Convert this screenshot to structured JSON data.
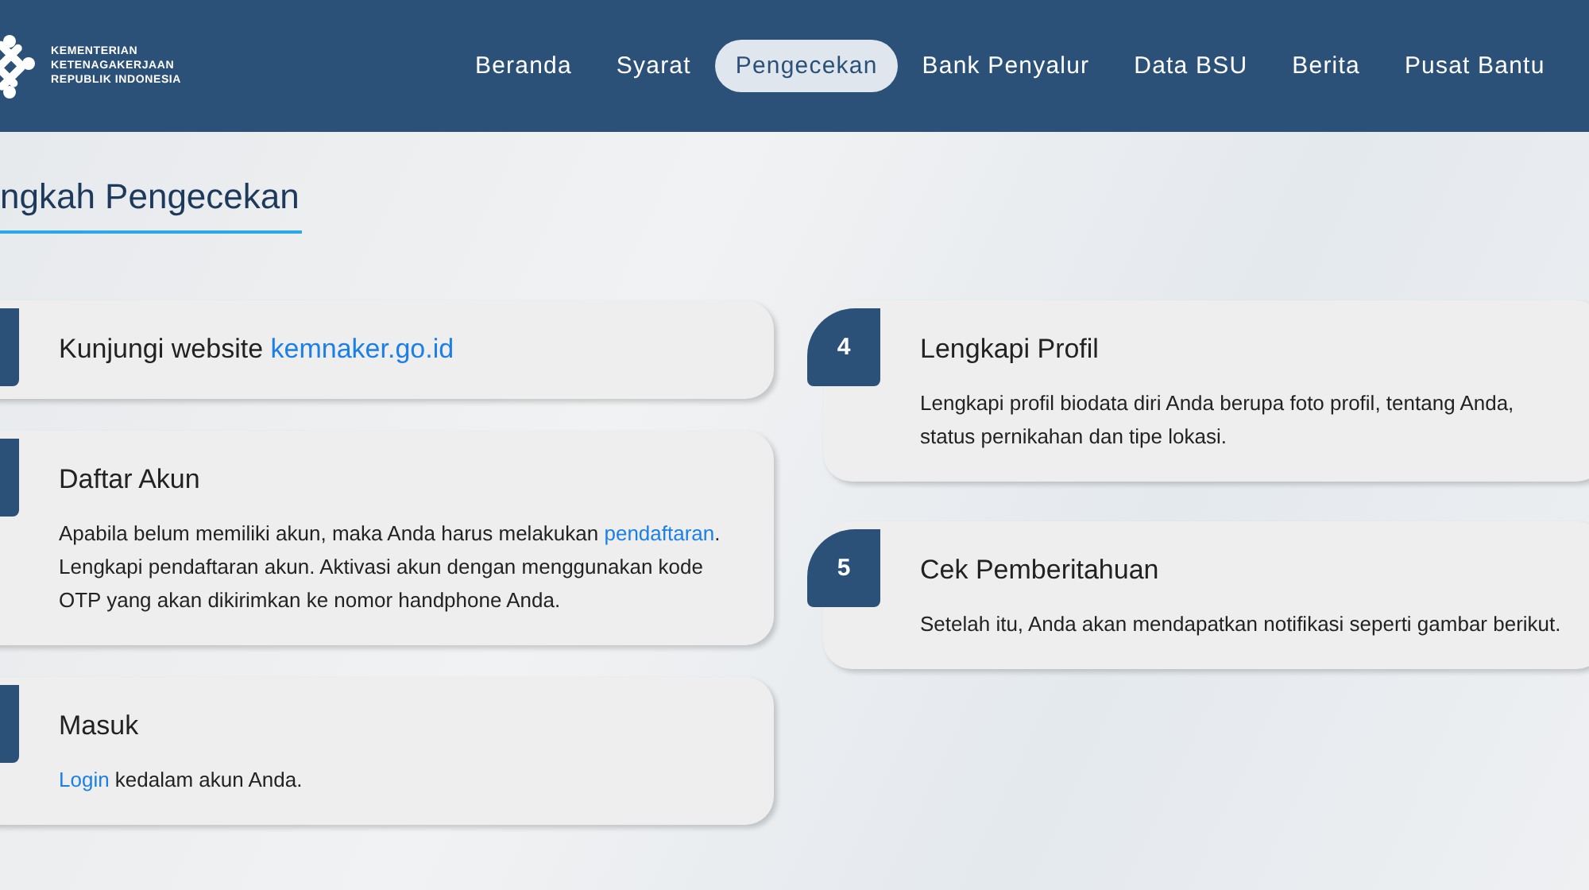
{
  "header": {
    "logo_lines": [
      "KEMENTERIAN",
      "KETENAGAKERJAAN",
      "REPUBLIK INDONESIA"
    ],
    "nav": [
      {
        "label": "Beranda",
        "selected": false
      },
      {
        "label": "Syarat",
        "selected": false
      },
      {
        "label": "Pengecekan",
        "selected": true
      },
      {
        "label": "Bank Penyalur",
        "selected": false
      },
      {
        "label": "Data BSU",
        "selected": false
      },
      {
        "label": "Berita",
        "selected": false
      },
      {
        "label": "Pusat Bantu",
        "selected": false
      }
    ]
  },
  "section_title": "ngkah Pengecekan",
  "left_steps": [
    {
      "title": [
        {
          "kind": "text",
          "text": "Kunjungi website "
        },
        {
          "kind": "link",
          "text": "kemnaker.go.id"
        }
      ]
    },
    {
      "title": [
        {
          "kind": "text",
          "text": "Daftar Akun"
        }
      ],
      "description": [
        {
          "kind": "text",
          "text": "Apabila belum memiliki akun, maka Anda harus melakukan "
        },
        {
          "kind": "link",
          "text": "pendaftaran"
        },
        {
          "kind": "text",
          "text": ". Lengkapi pendaftaran akun. Aktivasi akun dengan menggunakan kode OTP yang akan dikirimkan ke nomor handphone Anda."
        }
      ]
    },
    {
      "title": [
        {
          "kind": "text",
          "text": "Masuk"
        }
      ],
      "description": [
        {
          "kind": "link",
          "text": "Login"
        },
        {
          "kind": "text",
          "text": " kedalam akun Anda."
        }
      ]
    }
  ],
  "right_steps": [
    {
      "number": "4",
      "title": [
        {
          "kind": "text",
          "text": "Lengkapi Profil"
        }
      ],
      "description": [
        {
          "kind": "text",
          "text": "Lengkapi profil biodata diri Anda berupa foto profil, tentang Anda, status pernikahan dan tipe lokasi."
        }
      ]
    },
    {
      "number": "5",
      "title": [
        {
          "kind": "text",
          "text": "Cek Pemberitahuan"
        }
      ],
      "description": [
        {
          "kind": "text",
          "text": "Setelah itu, Anda akan mendapatkan notifikasi seperti gambar berikut."
        }
      ]
    }
  ]
}
